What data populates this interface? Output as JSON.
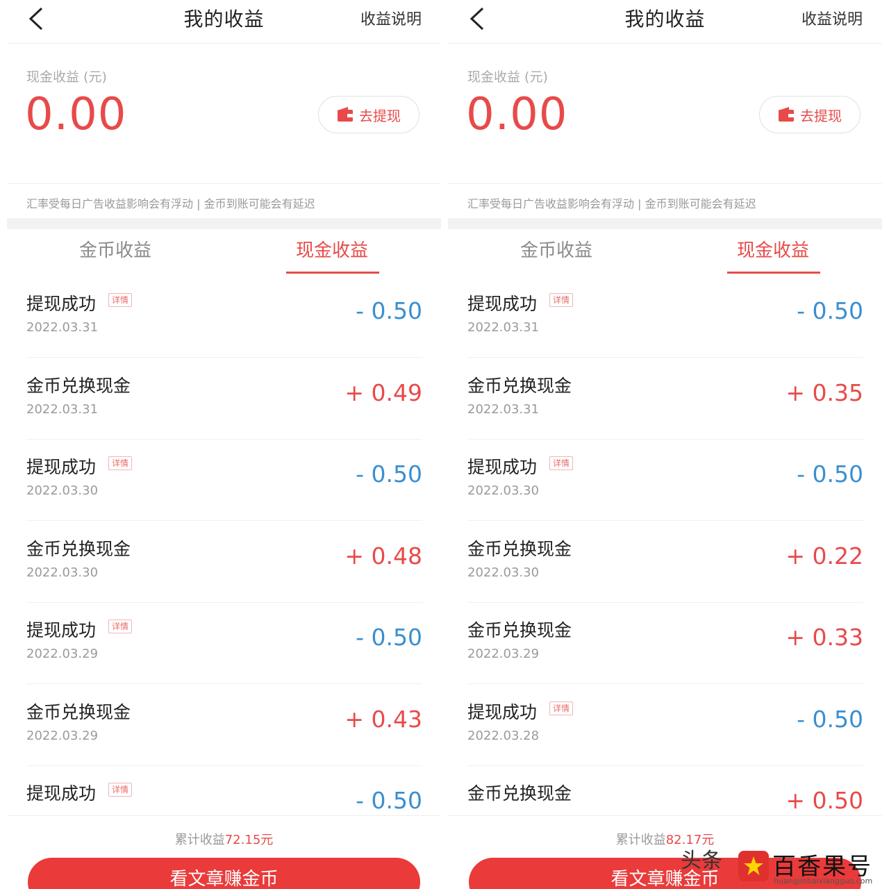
{
  "header": {
    "title": "我的收益",
    "help": "收益说明"
  },
  "cash_label": "现金收益 (元)",
  "cash_amount": "0.00",
  "withdraw_label": "去提现",
  "notice": "汇率受每日广告收益影响会有浮动 | 金币到账可能会有延迟",
  "tabs": {
    "coin": "金币收益",
    "cash": "现金收益"
  },
  "colors": {
    "accent": "#e84a4a",
    "negative": "#3a8fd0"
  },
  "panels": [
    {
      "total_label": "累计收益",
      "total_value": "72.15元",
      "cta": "看文章赚金币",
      "records": [
        {
          "title": "提现成功",
          "tag": "详情",
          "date": "2022.03.31",
          "amount": "- 0.50",
          "sign": "neg"
        },
        {
          "title": "金币兑换现金",
          "tag": "",
          "date": "2022.03.31",
          "amount": "+ 0.49",
          "sign": "pos"
        },
        {
          "title": "提现成功",
          "tag": "详情",
          "date": "2022.03.30",
          "amount": "- 0.50",
          "sign": "neg"
        },
        {
          "title": "金币兑换现金",
          "tag": "",
          "date": "2022.03.30",
          "amount": "+ 0.48",
          "sign": "pos"
        },
        {
          "title": "提现成功",
          "tag": "详情",
          "date": "2022.03.29",
          "amount": "- 0.50",
          "sign": "neg"
        },
        {
          "title": "金币兑换现金",
          "tag": "",
          "date": "2022.03.29",
          "amount": "+ 0.43",
          "sign": "pos"
        },
        {
          "title": "提现成功",
          "tag": "详情",
          "date": "",
          "amount": "- 0.50",
          "sign": "neg"
        }
      ]
    },
    {
      "total_label": "累计收益",
      "total_value": "82.17元",
      "cta": "看文章赚金币",
      "records": [
        {
          "title": "提现成功",
          "tag": "详情",
          "date": "2022.03.31",
          "amount": "- 0.50",
          "sign": "neg"
        },
        {
          "title": "金币兑换现金",
          "tag": "",
          "date": "2022.03.31",
          "amount": "+ 0.35",
          "sign": "pos"
        },
        {
          "title": "提现成功",
          "tag": "详情",
          "date": "2022.03.30",
          "amount": "- 0.50",
          "sign": "neg"
        },
        {
          "title": "金币兑换现金",
          "tag": "",
          "date": "2022.03.30",
          "amount": "+ 0.22",
          "sign": "pos"
        },
        {
          "title": "金币兑换现金",
          "tag": "",
          "date": "2022.03.29",
          "amount": "+ 0.33",
          "sign": "pos"
        },
        {
          "title": "提现成功",
          "tag": "详情",
          "date": "2022.03.28",
          "amount": "- 0.50",
          "sign": "neg"
        },
        {
          "title": "金币兑换现金",
          "tag": "",
          "date": "",
          "amount": "+ 0.50",
          "sign": "pos"
        }
      ]
    }
  ],
  "watermark": {
    "platform": "头条",
    "brand": "百香果号",
    "url": "huangjinbaixiangguo.com",
    "logo_icon": "star-flag-icon"
  }
}
